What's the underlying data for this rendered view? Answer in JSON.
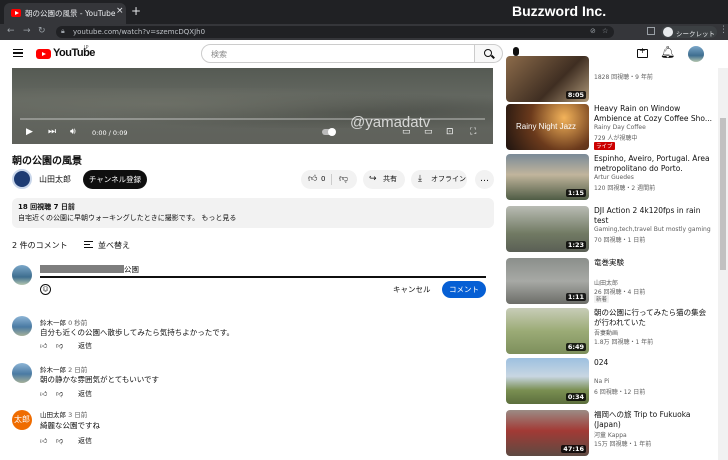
{
  "browser": {
    "tab_title": "朝の公園の風景 - YouTube",
    "tab_close": "×",
    "new_tab": "+",
    "url": "youtube.com/watch?v=szemcDQXJh0",
    "brand": "Buzzword Inc.",
    "profile_label": "シークレット"
  },
  "header": {
    "logo_text": "YouTube",
    "logo_country": "JP",
    "search_placeholder": "検索"
  },
  "player": {
    "time": "0:00 / 0:09",
    "watermark": "@yamadatv",
    "progress": 0
  },
  "video": {
    "title": "朝の公園の風景",
    "channel": "山田太郎",
    "subscribe": "チャンネル登録",
    "likes": "0",
    "share": "共有",
    "offline": "オフライン",
    "more": "…",
    "views_date": "18 回視聴  7 日前",
    "description": "自宅近くの公園に早朝ウォーキングしたときに撮影です。  もっと見る"
  },
  "comments": {
    "count": "2 件のコメント",
    "sort": "並べ替え",
    "input_value": "公園",
    "cancel": "キャンセル",
    "submit": "コメント",
    "items": [
      {
        "author": "鈴木一郎",
        "time": "0 秒前",
        "text": "自分も近くの公園へ散歩してみたら気持ちよかったです。",
        "reply": "返信"
      },
      {
        "author": "鈴木一郎",
        "time": "2 日前",
        "text": "朝の静かな雰囲気がとてもいいです",
        "reply": "返信"
      },
      {
        "author": "山田太郎",
        "time": "3 日前",
        "text": "綺麗な公園ですね",
        "reply": "返信",
        "avatar_text": "太郎"
      }
    ]
  },
  "sidebar": {
    "items": [
      {
        "title": "",
        "channel": "",
        "meta": "1828 回視聴・9 年前",
        "duration": "8:05"
      },
      {
        "title": "Heavy Rain on Window Ambience at Cozy Coffee Sho...",
        "channel": "Rainy Day Coffee",
        "meta": "729 人が視聴中",
        "badge": "ライブ",
        "thumb_text": "Rainy Night Jazz"
      },
      {
        "title": "Espinho, Aveiro, Portugal. Área metropolitano do Porto. Parqu...",
        "channel": "Artur Guedes",
        "meta": "120 回視聴・2 週間前",
        "duration": "1:15"
      },
      {
        "title": "DJI Action 2 4k120fps in rain test",
        "channel": "Gaming,tech,travel But mostly gaming",
        "meta": "70 回視聴・1 日前",
        "duration": "1:23"
      },
      {
        "title": "竜巻実験",
        "channel": "山田太郎",
        "meta": "26 回視聴・4 日前",
        "badge": "新着",
        "duration": "1:11"
      },
      {
        "title": "朝の公園に行ってみたら猫の集会が行われていた",
        "channel": "吾妻動画",
        "meta": "1.8万 回視聴・1 年前",
        "duration": "6:49"
      },
      {
        "title": "024",
        "channel": "Na Pi",
        "meta": "6 回視聴・12 日前",
        "duration": "0:34"
      },
      {
        "title": "福岡への旅 Trip to Fukuoka (Japan)",
        "channel": "河童 Kappa",
        "meta": "15万 回視聴・1 年前",
        "duration": "47:16"
      }
    ]
  },
  "colors": {
    "accent": "#065fd4",
    "youtube_red": "#ff0000",
    "live_badge": "#cc0000"
  }
}
